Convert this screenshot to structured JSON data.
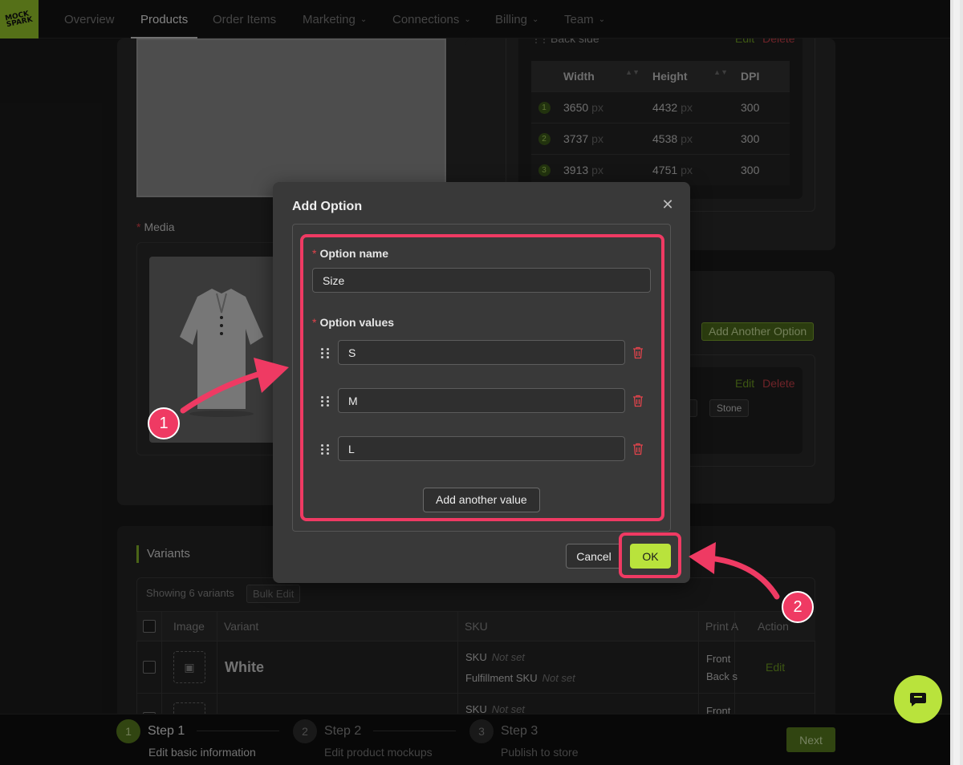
{
  "nav": {
    "logo_text": "MOCK SPARK",
    "items": [
      {
        "label": "Overview",
        "active": false,
        "dropdown": false
      },
      {
        "label": "Products",
        "active": true,
        "dropdown": false
      },
      {
        "label": "Order Items",
        "active": false,
        "dropdown": false
      },
      {
        "label": "Marketing",
        "active": false,
        "dropdown": true
      },
      {
        "label": "Connections",
        "active": false,
        "dropdown": true
      },
      {
        "label": "Billing",
        "active": false,
        "dropdown": true
      },
      {
        "label": "Team",
        "active": false,
        "dropdown": true
      }
    ]
  },
  "background": {
    "media_label": "Media",
    "print_area": {
      "back_side_label": "Back side",
      "edit_label": "Edit",
      "delete_label": "Delete",
      "table": {
        "headers": [
          "Width",
          "Height",
          "DPI"
        ],
        "rows": [
          {
            "n": "1",
            "width": "3650",
            "height": "4432",
            "dpi": "300"
          },
          {
            "n": "2",
            "width": "3737",
            "height": "4538",
            "dpi": "300"
          },
          {
            "n": "3",
            "width": "3913",
            "height": "4751",
            "dpi": "300"
          }
        ],
        "unit": "px"
      }
    },
    "options": {
      "add_another_option": "Add Another Option",
      "edit_label": "Edit",
      "delete_label": "Delete",
      "tags": [
        "ed",
        "Stone"
      ]
    },
    "variants": {
      "title": "Variants",
      "showing": "Showing 6 variants",
      "bulk_edit": "Bulk Edit",
      "headers": {
        "image": "Image",
        "variant": "Variant",
        "sku": "SKU",
        "print": "Print A",
        "action": "Action"
      },
      "rows": [
        {
          "name": "White",
          "sku_label": "SKU",
          "sku_value": "Not set",
          "fsku_label": "Fulfillment SKU",
          "fsku_value": "Not set",
          "print_1": "Front",
          "print_2": "Back s",
          "action": "Edit"
        },
        {
          "sku_label": "SKU",
          "sku_value": "Not set",
          "print_1": "Front"
        }
      ]
    }
  },
  "steps": [
    {
      "num": "1",
      "title": "Step 1",
      "subtitle": "Edit basic information",
      "active": true
    },
    {
      "num": "2",
      "title": "Step 2",
      "subtitle": "Edit product mockups",
      "active": false
    },
    {
      "num": "3",
      "title": "Step 3",
      "subtitle": "Publish to store",
      "active": false
    }
  ],
  "next_label": "Next",
  "modal": {
    "title": "Add Option",
    "option_name_label": "Option name",
    "option_name_value": "Size",
    "option_values_label": "Option values",
    "values": [
      "S",
      "M",
      "L"
    ],
    "add_value_label": "Add another value",
    "cancel_label": "Cancel",
    "ok_label": "OK"
  },
  "annotations": {
    "badge_1": "1",
    "badge_2": "2",
    "color": "#ef3a63"
  },
  "colors": {
    "accent": "#b9e33c",
    "danger": "#c9404a",
    "bg": "#1b1b1b"
  },
  "icons": [
    "close-icon",
    "drag-handle-icon",
    "trash-icon",
    "chevron-down-icon",
    "sort-icon",
    "image-icon",
    "chat-icon"
  ]
}
